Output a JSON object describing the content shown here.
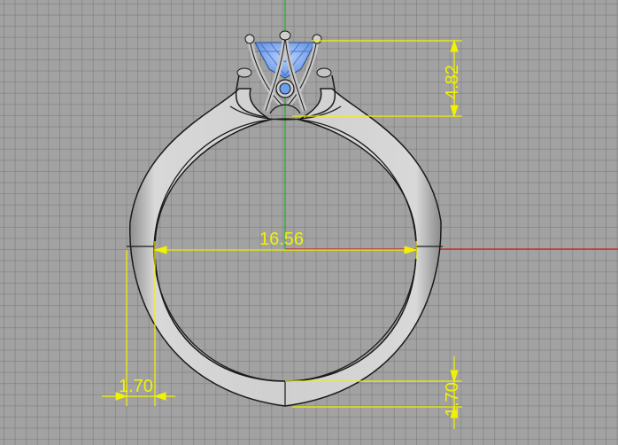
{
  "viewport": {
    "view": "Front",
    "background": "#a2a2a2",
    "grid_color": "#8c8c8c",
    "x_axis_color": "#c81e1e",
    "y_axis_color": "#1fb31f"
  },
  "model": {
    "object": "ring",
    "stone_color": "#7aaaf2",
    "metal_color": "#c9c9c9"
  },
  "dimensions": {
    "dimension_color": "#f2f200",
    "inner_diameter": "16.56",
    "setting_height": "4.82",
    "shank_width": "1.70",
    "bottom_thickness": "1.70"
  }
}
